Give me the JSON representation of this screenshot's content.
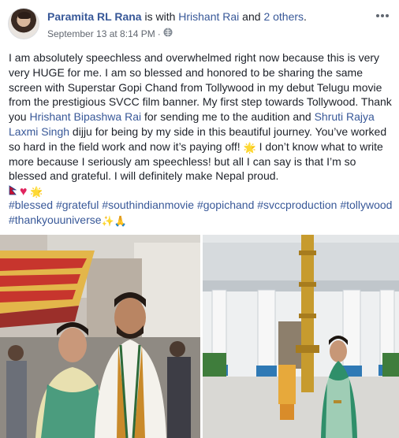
{
  "post": {
    "author": "Paramita RL Rana",
    "with_text": " is with ",
    "tagged_person": "Hrishant Rai",
    "and_text": " and ",
    "others": "2 others",
    "period": ".",
    "date": "September 13 at 8:14 PM",
    "separator": "·",
    "more_icon": "more-dots-icon",
    "body": {
      "p1": "I am absolutely speechless and overwhelmed right now because this is very very HUGE for me. I am so blessed and honored to be sharing the same screen with Superstar Gopi Chand from Tollywood in my debut Telugu movie from the prestigious SVCC film banner. My first step towards Tollywood. Thank you ",
      "mention1": "Hrishant Bipashwa Rai",
      "p2": " for sending me to the audition and ",
      "mention2": "Shruti Rajya Laxmi Singh",
      "p3": " dijju for being by my side in this beautiful journey. You’ve worked so hard in the field work and now it’s paying off! ",
      "p4": " I don’t know what to write more because I seriously am speechless! but all I can say is that I’m so blessed and grateful. I will definitely make Nepal proud."
    },
    "emoji": {
      "sparkle": "🌟",
      "flag": "🇳🇵",
      "heart": "♥",
      "sparkles": "✨",
      "pray": "🙏"
    },
    "hashtags": [
      "#blessed",
      "#grateful",
      "#southindianmovie",
      "#gopichand",
      "#svccproduction",
      "#tollywood",
      "#thankyouuniverse"
    ],
    "photos": [
      "photo-with-actor",
      "temple-photo"
    ]
  },
  "colors": {
    "link": "#385898",
    "text": "#1d2129",
    "meta": "#616770"
  }
}
